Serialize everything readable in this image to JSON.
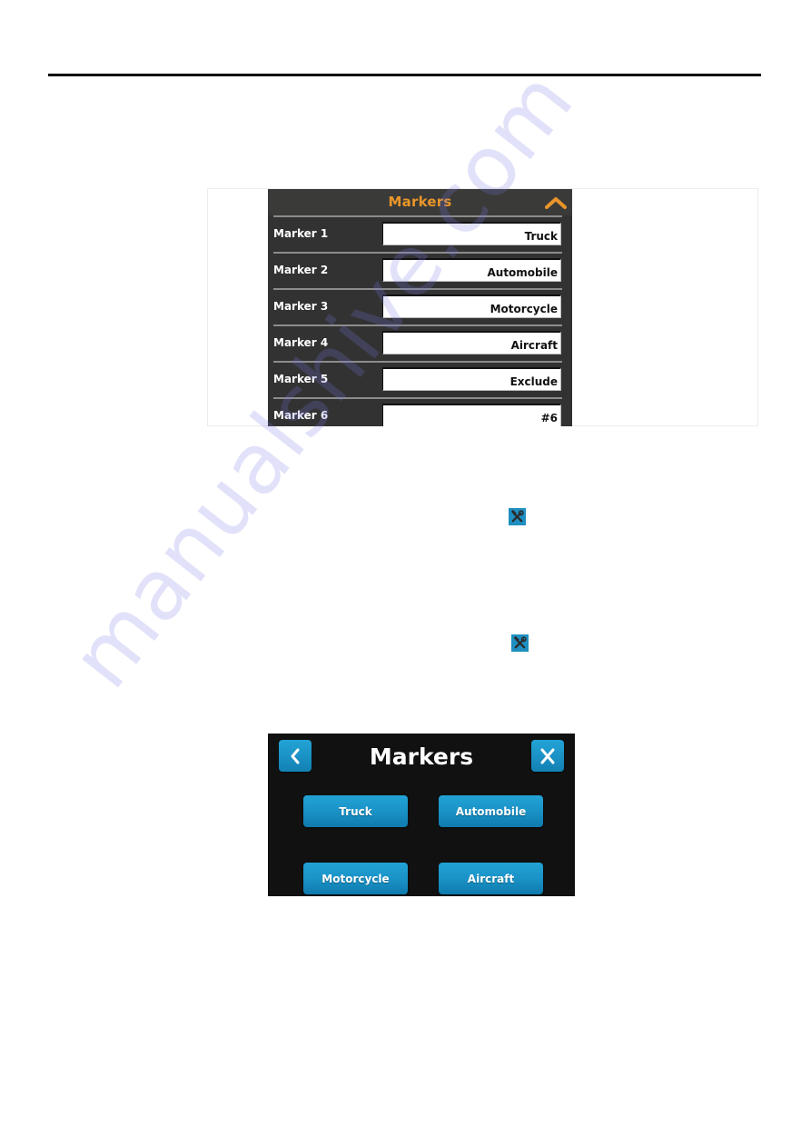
{
  "settings_panel": {
    "title": "Markers",
    "collapse_icon": "chevron-up-icon",
    "accent_color": "#e8952a",
    "rows": [
      {
        "label": "Marker 1",
        "value": "Truck"
      },
      {
        "label": "Marker 2",
        "value": "Automobile"
      },
      {
        "label": "Marker 3",
        "value": "Motorcycle"
      },
      {
        "label": "Marker 4",
        "value": "Aircraft"
      },
      {
        "label": "Marker 5",
        "value": "Exclude"
      },
      {
        "label": "Marker 6",
        "value": "#6"
      }
    ]
  },
  "inline_icons": [
    {
      "icon": "tools-icon",
      "color": "#1e8fc0"
    },
    {
      "icon": "tools-icon",
      "color": "#1e8fc0"
    }
  ],
  "markers_panel": {
    "title": "Markers",
    "back_icon": "chevron-left-icon",
    "close_icon": "close-icon",
    "back_label": "‹",
    "close_label": "X",
    "button_color": "#1a93c7",
    "buttons": [
      {
        "label": "Truck"
      },
      {
        "label": "Automobile"
      },
      {
        "label": "Motorcycle"
      },
      {
        "label": "Aircraft"
      }
    ]
  },
  "watermark": {
    "text": "manualshive.com"
  }
}
